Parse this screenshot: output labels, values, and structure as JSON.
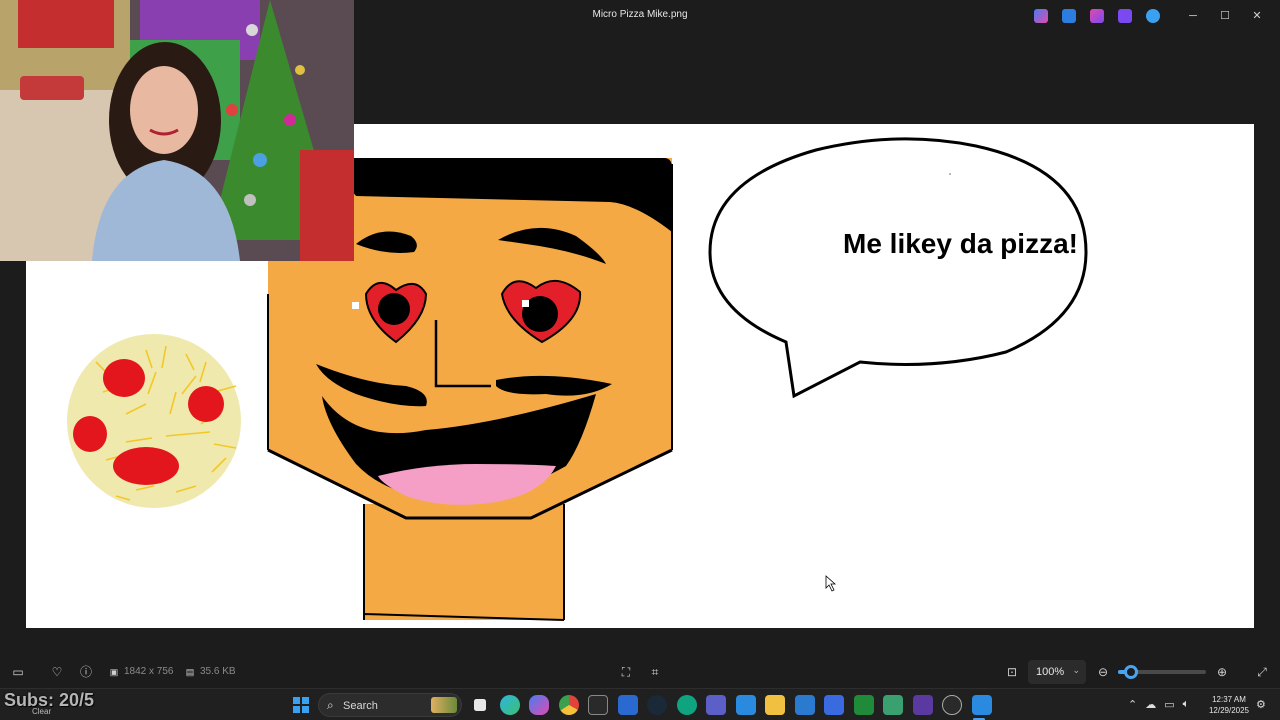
{
  "window": {
    "title": "Micro Pizza Mike.png",
    "controls": {
      "minimize": "─",
      "maximize": "☐",
      "close": "✕"
    }
  },
  "image": {
    "speech_text": "Me likey da pizza!",
    "colors": {
      "skin": "#f5a945",
      "hair": "#000000",
      "heart": "#e3202a",
      "tongue": "#f59ec6",
      "pizza_base": "#efe9ad",
      "pepperoni": "#e3161d",
      "cheese": "#f2c827"
    }
  },
  "statusbar": {
    "dimensions": "1842 x 756",
    "file_size": "35.6 KB",
    "zoom": "100%",
    "zoom_level": 0.15
  },
  "taskbar": {
    "overlay_text": "Subs: 20/5",
    "weather_label": "Clear",
    "search_label": "Search",
    "clock_time": "12:37 AM",
    "clock_date": "12/29/2025"
  },
  "icons": {
    "gallery": "gallery-icon",
    "favorite": "heart-icon",
    "info": "info-icon",
    "fit": "fit-icon",
    "zoom_out": "zoom-out-icon",
    "zoom_in": "zoom-in-icon",
    "fullscreen": "fullscreen-icon"
  }
}
